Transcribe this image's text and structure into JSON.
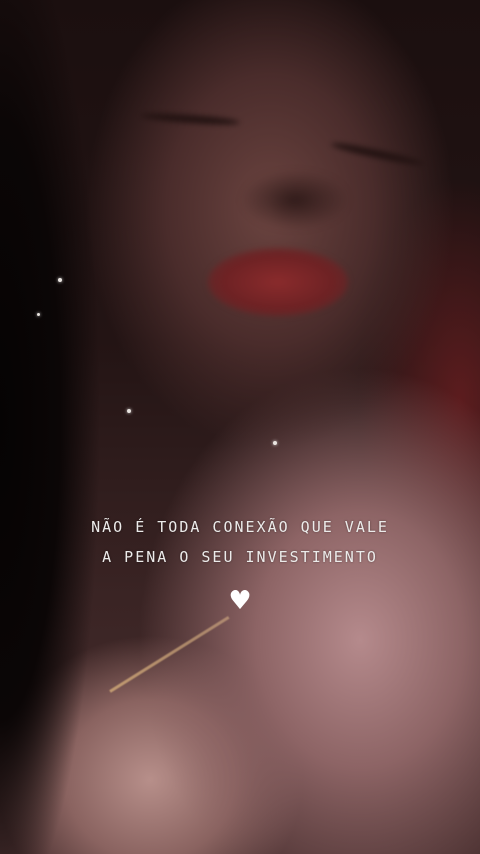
{
  "caption": {
    "line1": "NÃO É TODA CONEXÃO QUE VALE",
    "line2": "A PENA O SEU INVESTIMENTO"
  },
  "sticker": {
    "icon": "white-heart-icon",
    "glyph": "♥",
    "color": "#ffffff"
  },
  "colors": {
    "caption_text": "#ecebea",
    "background": "#1b0f0f"
  }
}
